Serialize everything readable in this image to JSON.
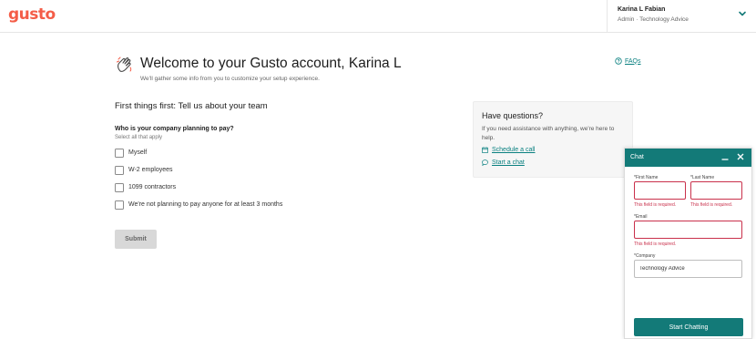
{
  "header": {
    "logo": "gusto",
    "account_name": "Karina L Fabian",
    "account_role": "Admin · Technology Advice"
  },
  "welcome": {
    "title": "Welcome to your Gusto account, Karina L",
    "subtitle": "We'll gather some info from you to customize your setup experience.",
    "faqs": "FAQs"
  },
  "form": {
    "section_title": "First things first: Tell us about your team",
    "question": "Who is your company planning to pay?",
    "question_hint": "Select all that apply",
    "options": [
      {
        "label": "Myself",
        "checked": false
      },
      {
        "label": "W-2 employees",
        "checked": false
      },
      {
        "label": "1099 contractors",
        "checked": false
      },
      {
        "label": "We're not planning to pay anyone for at least 3 months",
        "checked": false
      }
    ],
    "submit": "Submit"
  },
  "questions_card": {
    "title": "Have questions?",
    "text": "If you need assistance with anything, we're here to help.",
    "schedule_call": "Schedule a call",
    "start_chat": "Start a chat"
  },
  "chat": {
    "title": "Chat",
    "first_name_label": "*First Name",
    "first_name_value": "",
    "first_name_error": "This field is required.",
    "last_name_label": "*Last Name",
    "last_name_value": "",
    "last_name_error": "This field is required.",
    "email_label": "*Email",
    "email_value": "",
    "email_error": "This field is required.",
    "company_label": "*Company",
    "company_value": "Technology Advice",
    "start_button": "Start Chatting"
  },
  "colors": {
    "brand": "#f45d48",
    "accent": "#137a78",
    "link": "#0a8080",
    "error": "#c9304b"
  }
}
